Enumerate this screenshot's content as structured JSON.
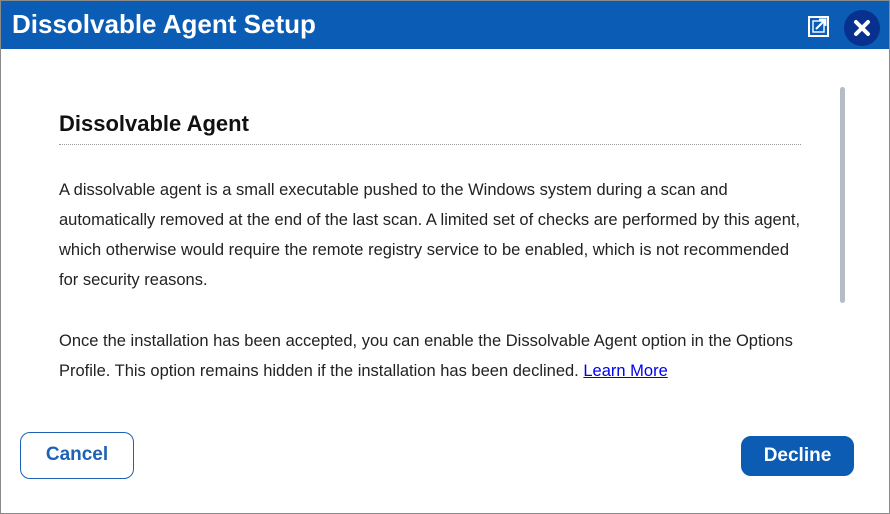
{
  "window": {
    "title": "Dissolvable Agent Setup",
    "popout_icon": "external-window-icon",
    "close_icon": "close-icon"
  },
  "content": {
    "heading": "Dissolvable Agent",
    "paragraph1": "A dissolvable agent is a small executable pushed to the Windows system during a scan and automatically removed at the end of the last scan. A limited set of checks are performed by this agent, which otherwise would require the remote registry service to be enabled, which is not recommended for security reasons.",
    "paragraph2": "Once the installation has been accepted, you can enable the Dissolvable Agent option in the Options Profile. This option remains hidden if the installation has been declined.",
    "learn_more": "Learn More"
  },
  "buttons": {
    "cancel": "Cancel",
    "decline": "Decline"
  },
  "colors": {
    "titlebar": "#0a5cb4",
    "close_circle": "#08308f",
    "primary_button": "#0b5cb2",
    "link": "#0000ee"
  }
}
